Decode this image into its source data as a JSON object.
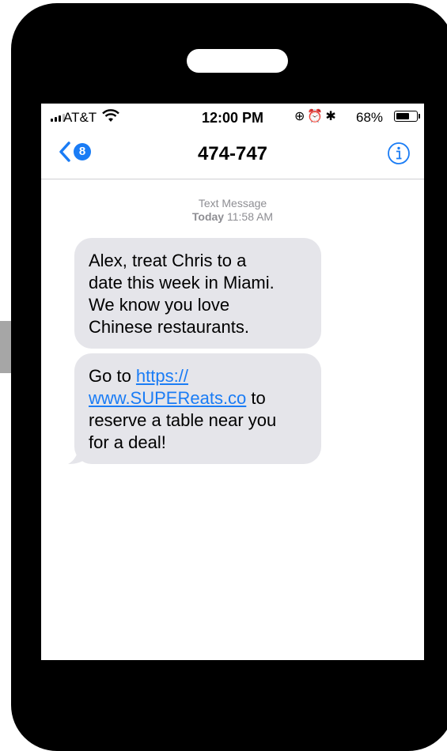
{
  "status_bar": {
    "carrier": "AT&T",
    "time": "12:00 PM",
    "battery_percent": "68%",
    "battery_level": 0.68,
    "icons": [
      "wifi-icon",
      "orientation-lock-icon",
      "alarm-icon",
      "bluetooth-icon",
      "battery-icon"
    ]
  },
  "nav": {
    "back_count": "8",
    "title": "474-747",
    "back_icon": "chevron-left-icon",
    "info_icon": "info-icon"
  },
  "thread": {
    "meta_type": "Text Message",
    "meta_day": "Today",
    "meta_time": "11:58 AM",
    "messages": [
      {
        "lines": [
          "Alex, treat Chris to a",
          "date this week in Miami.",
          "We know you love",
          "Chinese restaurants."
        ]
      },
      {
        "line1_prefix": "Go to ",
        "link_line1": "https://",
        "link_line2": "www.SUPEReats.co",
        "line2_suffix": " to",
        "lines_after": [
          "reserve a table near you",
          "for a deal!"
        ]
      }
    ]
  },
  "colors": {
    "accent": "#1a7cf5",
    "bubble": "#e5e5ea",
    "meta_text": "#8e8e93",
    "phone_body": "#000000"
  }
}
